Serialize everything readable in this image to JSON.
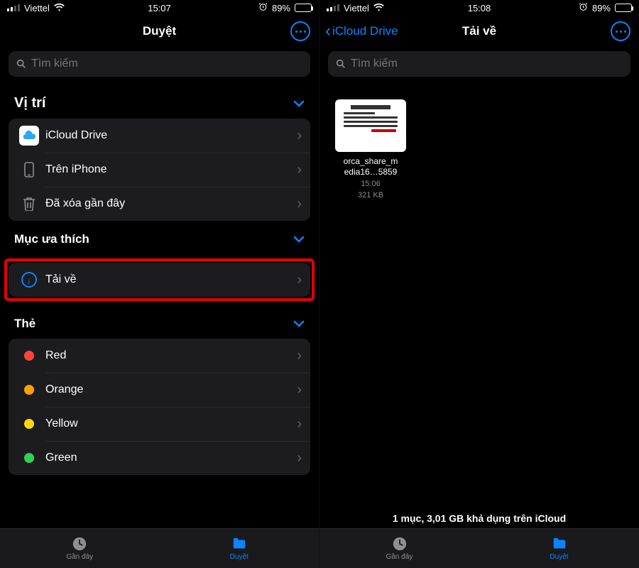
{
  "status": {
    "carrier": "Viettel",
    "battery_pct": "89%"
  },
  "left": {
    "time": "15:07",
    "title": "Duyệt",
    "search_placeholder": "Tìm kiếm",
    "sections": {
      "locations": {
        "label": "Vị trí",
        "items": {
          "icloud": "iCloud Drive",
          "on_device": "Trên iPhone",
          "recently_deleted": "Đã xóa gần đây"
        }
      },
      "favorites": {
        "label": "Mục ưa thích",
        "downloads": "Tải về"
      },
      "tags": {
        "label": "Thẻ",
        "items": {
          "red": {
            "label": "Red",
            "color": "#ff453a"
          },
          "orange": {
            "label": "Orange",
            "color": "#ff9f0a"
          },
          "yellow": {
            "label": "Yellow",
            "color": "#ffd60a"
          },
          "green": {
            "label": "Green",
            "color": "#30d158"
          }
        }
      }
    },
    "tabs": {
      "recents": "Gần đây",
      "browse": "Duyệt"
    }
  },
  "right": {
    "time": "15:08",
    "back_label": "iCloud Drive",
    "title": "Tải về",
    "search_placeholder": "Tìm kiếm",
    "file": {
      "name_line1": "orca_share_m",
      "name_line2": "edia16…5859",
      "time": "15:06",
      "size": "321 KB"
    },
    "footer": "1 mục, 3,01 GB khả dụng trên iCloud",
    "tabs": {
      "recents": "Gần đây",
      "browse": "Duyệt"
    }
  }
}
